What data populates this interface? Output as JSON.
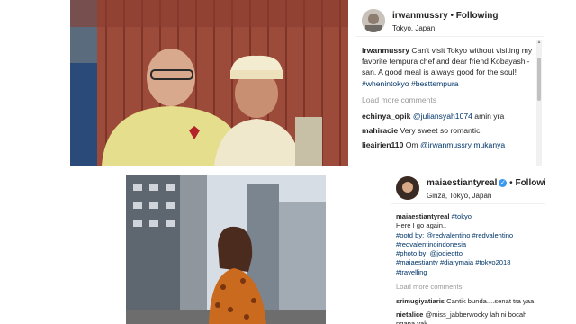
{
  "post1": {
    "username": "irwanmussry",
    "follow_label": "Following",
    "location": "Tokyo, Japan",
    "caption_user": "irwanmussry",
    "caption_text": "Can't visit Tokyo without visiting my favorite tempura chef and dear friend Kobayashi-san. A good meal is always good for the soul!",
    "caption_tags": "#whenintokyo #besttempura",
    "load_more": "Load more comments",
    "comments": [
      {
        "user": "echinya_opik",
        "mention": "@juliansyah1074",
        "text": " amin yra"
      },
      {
        "user": "mahiracie",
        "mention": "",
        "text": "Very sweet so romantic"
      },
      {
        "user": "lieairien110",
        "mention": "Om ",
        "text": "@irwanmussry mukanya"
      }
    ]
  },
  "post2": {
    "username": "maiaestiantyreal",
    "follow_label": "Following",
    "location": "Ginza, Tokyo, Japan",
    "caption_user": "maiaestiantyreal",
    "caption_lines": [
      "#tokyo",
      "Here I go again..",
      "#ootd by: @redvalentino #redvalentino",
      "#redvalentinoindonesia",
      "#photo by: @jodieotto",
      "#maiaestianty #diarymaia #tokyo2018",
      "#travelling"
    ],
    "load_more": "Load more comments",
    "comments": [
      {
        "user": "srimugiyatiaris",
        "text": "Cantik bunda....senat tra yaa"
      },
      {
        "user": "nietalice",
        "text": "@miss_jabberwocky lah ni bocah ngapa yak"
      }
    ]
  },
  "colors": {
    "link": "#003569",
    "muted": "#999999",
    "accent": "#3897f0"
  }
}
